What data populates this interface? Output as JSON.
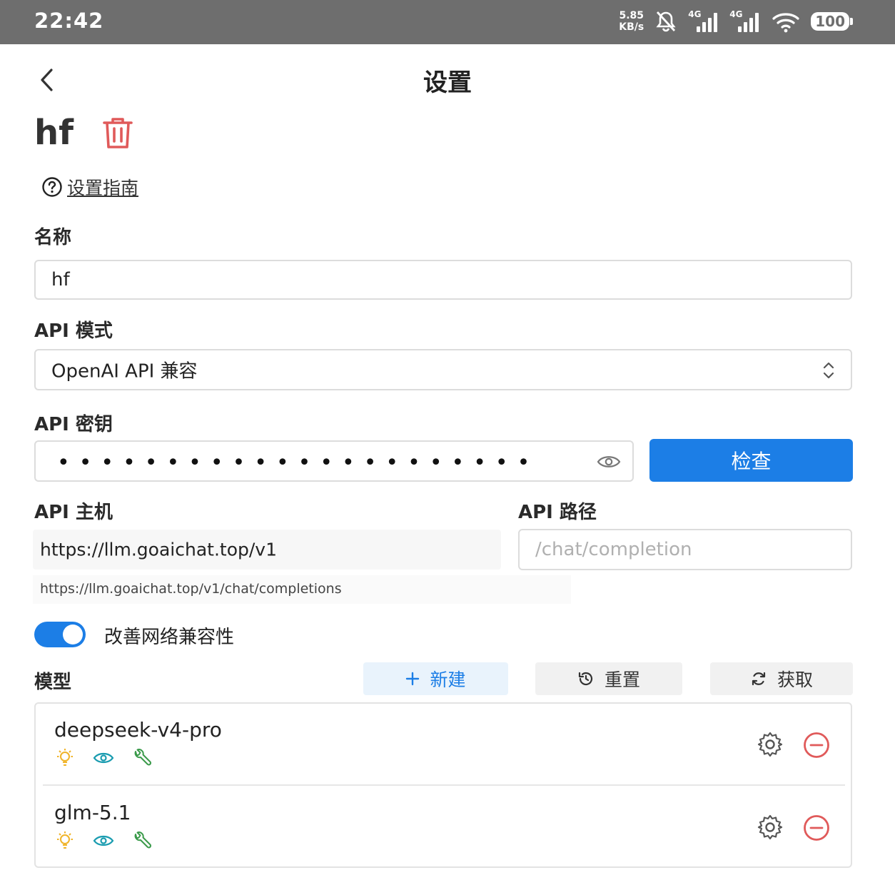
{
  "status_bar": {
    "time": "22:42",
    "speed_value": "5.85",
    "speed_unit": "KB/s",
    "network_1": "4G",
    "network_2": "4G",
    "battery": "100",
    "icons": [
      "mute-bell-icon",
      "signal-icon",
      "signal-icon",
      "wifi-icon",
      "battery-icon"
    ]
  },
  "header": {
    "title": "设置",
    "back_icon": "chevron-left-icon"
  },
  "profile": {
    "name": "hf",
    "delete_icon": "trash-icon",
    "delete_color": "#e05a5a"
  },
  "guide": {
    "label": "设置指南",
    "icon": "question-circle-icon"
  },
  "form": {
    "name_label": "名称",
    "name_value": "hf",
    "api_mode_label": "API 模式",
    "api_mode_value": "OpenAI API 兼容",
    "api_key_label": "API 密钥",
    "api_key_masked": "••••••••••••••••••••••",
    "check_label": "检查",
    "api_host_label": "API 主机",
    "api_host_value": "https://llm.goaichat.top/v1",
    "api_host_hint": "https://llm.goaichat.top/v1/chat/completions",
    "api_path_label": "API 路径",
    "api_path_placeholder": "/chat/completion",
    "network_compat_label": "改善网络兼容性",
    "network_compat_enabled": true
  },
  "models": {
    "label": "模型",
    "new_label": "新建",
    "reset_label": "重置",
    "fetch_label": "获取",
    "items": [
      {
        "name": "deepseek-v4-pro",
        "capabilities": [
          "reasoning-bulb-icon",
          "vision-eye-icon",
          "tool-wrench-icon"
        ]
      },
      {
        "name": "glm-5.1",
        "capabilities": [
          "reasoning-bulb-icon",
          "vision-eye-icon",
          "tool-wrench-icon"
        ]
      }
    ]
  },
  "colors": {
    "accent": "#1c7ee6",
    "danger": "#e05a5a",
    "bulb": "#f0b429",
    "eye": "#1a9cb0",
    "wrench": "#3a9a4a",
    "status_bar": "#6e6e6e"
  }
}
